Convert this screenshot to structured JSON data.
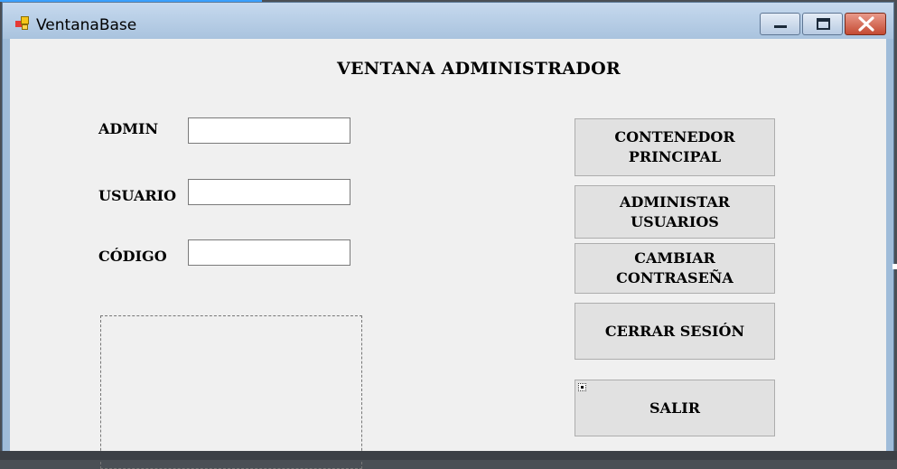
{
  "window": {
    "title": "VentanaBase",
    "icon": "app-icon",
    "controls": {
      "minimize": "minimize-icon",
      "maximize": "maximize-icon",
      "close": "close-icon"
    },
    "colors": {
      "titlebar": "#a9c3de",
      "client": "#f0f0f0",
      "close": "#c44a32"
    }
  },
  "main": {
    "heading": "VENTANA ADMINISTRADOR",
    "fields": [
      {
        "label": "ADMIN",
        "value": "",
        "placeholder": ""
      },
      {
        "label": "USUARIO",
        "value": "",
        "placeholder": ""
      },
      {
        "label": "CÓDIGO",
        "value": "",
        "placeholder": ""
      }
    ]
  },
  "buttons": {
    "contenedor": [
      "CONTENEDOR",
      "PRINCIPAL"
    ],
    "administrar": [
      "ADMINISTAR",
      "USUARIOS"
    ],
    "cambiar": [
      "CAMBIAR",
      "CONTRASEÑA"
    ],
    "cerrar": "CERRAR SESIÓN",
    "salir": "SALIR"
  }
}
